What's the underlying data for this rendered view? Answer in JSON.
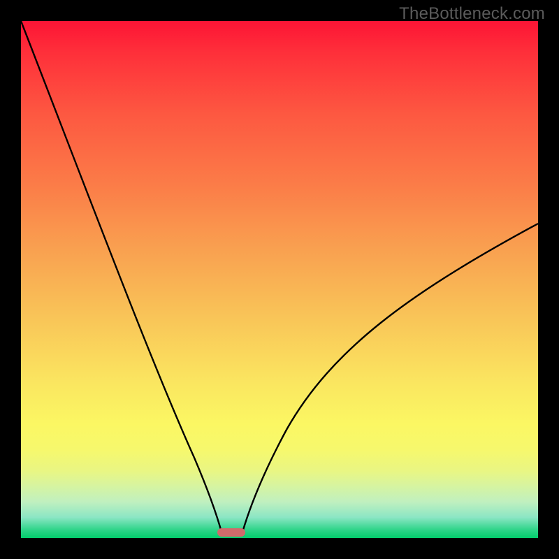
{
  "watermark": {
    "text": "TheBottleneck.com"
  },
  "colors": {
    "page_bg": "#000000",
    "watermark": "#5b5b5b",
    "curve": "#000000",
    "marker": "#d06b6b",
    "gradient_top": "#fd1435",
    "gradient_bottom": "#02cc6c"
  },
  "chart_data": {
    "type": "line",
    "title": "",
    "xlabel": "",
    "ylabel": "",
    "xlim": [
      0,
      100
    ],
    "ylim": [
      0,
      100
    ],
    "grid": false,
    "legend": false,
    "notes": "Bottleneck-style V curve on red→green vertical gradient. No axis ticks or labels are rendered. Values estimated from pixel positions.",
    "series": [
      {
        "name": "left-branch",
        "x": [
          0,
          4,
          8,
          12,
          16,
          20,
          24,
          28,
          32,
          35,
          37,
          38.5
        ],
        "y": [
          100,
          90,
          79,
          68,
          57,
          46,
          35,
          25,
          15,
          7,
          2,
          0
        ]
      },
      {
        "name": "right-branch",
        "x": [
          42,
          44,
          48,
          54,
          60,
          66,
          74,
          82,
          90,
          100
        ],
        "y": [
          0,
          2,
          7,
          15,
          23,
          30,
          38,
          46,
          53,
          61
        ]
      }
    ],
    "marker": {
      "name": "bottleneck-marker",
      "x_start": 38,
      "x_end": 43,
      "y": 0
    }
  }
}
